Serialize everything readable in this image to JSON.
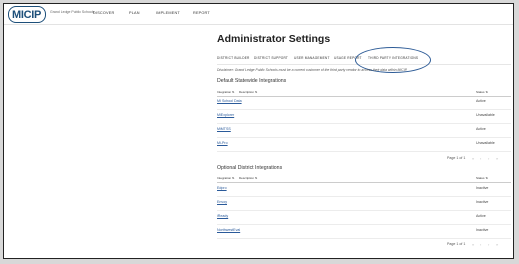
{
  "header": {
    "logo_text": "MICIP",
    "logo_sub": "Grand Ledge Public Schools",
    "nav": [
      "DISCOVER",
      "PLAN",
      "IMPLEMENT",
      "REPORT"
    ]
  },
  "page": {
    "title": "Administrator Settings",
    "tabs": [
      "DISTRICT BUILDER",
      "DISTRICT SUPPORT",
      "USER MANAGEMENT",
      "USAGE REPORT",
      "THIRD PARTY INTEGRATIONS"
    ],
    "active_tab": "THIRD PARTY INTEGRATIONS",
    "disclaimer": "Disclaimer: Grand Ledge Public Schools must be a current customer of the third party vendor to access their data within MICIP."
  },
  "default_section": {
    "title": "Default Statewide Integrations",
    "columns": [
      "Integration ⇅",
      "Description ⇅",
      "Status ⇅"
    ],
    "rows": [
      {
        "name": "MI School Data",
        "status": "Active"
      },
      {
        "name": "MiExplorer",
        "status": "Unavailable"
      },
      {
        "name": "MiMTSS",
        "status": "Active"
      },
      {
        "name": "Mi-Pro",
        "status": "Unavailable"
      }
    ],
    "pager": "Page 1 of 1"
  },
  "optional_section": {
    "title": "Optional District Integrations",
    "columns": [
      "Integration ⇅",
      "Description ⇅",
      "Status ⇅"
    ],
    "rows": [
      {
        "name": "Edpro",
        "status": "Inactive"
      },
      {
        "name": "Envoy",
        "status": "Inactive"
      },
      {
        "name": "iReady",
        "status": "Active"
      },
      {
        "name": "NorthwestEval",
        "status": "Inactive"
      }
    ],
    "pager": "Page 1 of 1"
  },
  "pager_buttons": [
    "«",
    "‹",
    "›",
    "»"
  ],
  "colors": {
    "brand": "#1d4f7a",
    "link": "#2a5a9a",
    "highlight_oval": "#2e5c97"
  }
}
